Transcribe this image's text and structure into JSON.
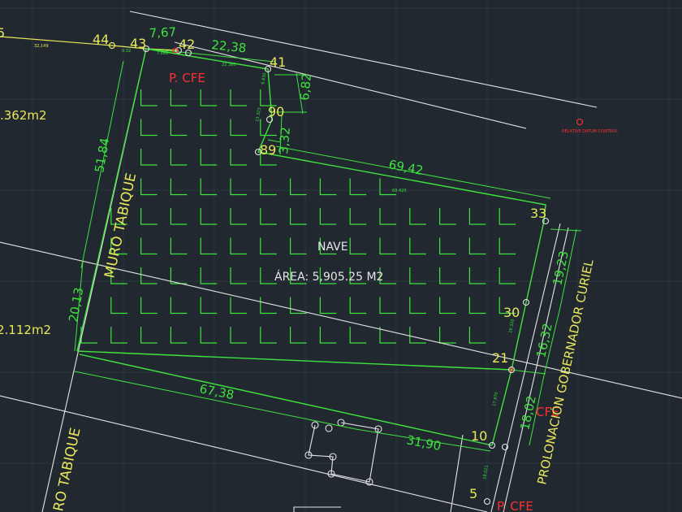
{
  "labels": {
    "nave": "NAVE",
    "area": "ÁREA: 5,905.25  M2",
    "muro_tabique": "MURO TABIQUE",
    "muro_tabique_lower": "RO TABIQUE",
    "prolongacion": "PROLONACIÓN GOBERNADOR CURIEL",
    "area_left_top": ".362m2",
    "area_left_bottom": "2.112m2"
  },
  "pcfe_labels": [
    "P. CFE",
    "P. CFE",
    "CFE"
  ],
  "dimensions": [
    "7,67",
    "22,38",
    "6,82",
    "3,32",
    "69,42",
    "51,84",
    "20,13",
    "19,23",
    "16,32",
    "18,02",
    "67,38",
    "31,90"
  ],
  "points": [
    "44",
    "43",
    "42",
    "41",
    "90",
    "89",
    "33",
    "30",
    "21",
    "10",
    "5"
  ],
  "edge_left_label": "5",
  "colors": {
    "background": "#212830",
    "green": "#3ee33e",
    "yellow": "#e8e85a",
    "white": "#e6e6e6",
    "red": "#ff3030"
  }
}
